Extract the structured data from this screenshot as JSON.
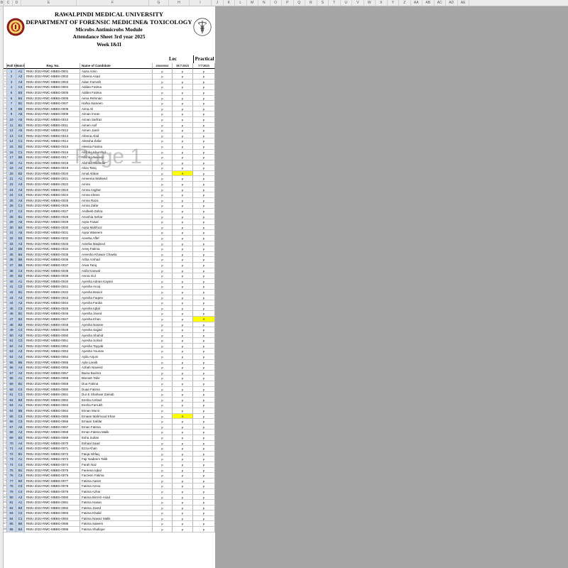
{
  "column_letters": [
    "B",
    "C",
    "D",
    "E",
    "F",
    "G",
    "H",
    "I",
    "J",
    "K",
    "L",
    "M",
    "N",
    "O",
    "P",
    "Q",
    "R",
    "S",
    "T",
    "U",
    "V",
    "W",
    "X",
    "Y",
    "Z",
    "AA",
    "AB",
    "AC",
    "AD",
    "AE"
  ],
  "header": {
    "university": "RAWALPINDI MEDICAL UNIVERSITY",
    "department": "DEPARTMENT OF FORENSIC MEDICINE& TOXICOLOGY",
    "module": "Microbs Antimicrobs Module",
    "sheet": "Attendance Sheet 3rd year 2025",
    "week": "Week I&II"
  },
  "groups": {
    "lec": "Lec",
    "practical": "Practical"
  },
  "columns": {
    "roll": "Roll No.",
    "batch": "Batch",
    "reg": "Reg. No.",
    "name": "Name of Candidate",
    "d1": "########",
    "d2": "18/7/2025",
    "d3": "7/7/2025"
  },
  "watermark": "Page 1",
  "rows": [
    {
      "sr": "3",
      "roll": "1",
      "batch": "A1",
      "reg": "RMU-2022-RMC-MBBS-0001",
      "name": "Aaira Amin",
      "d1": "p",
      "d2": "p",
      "d3": "p"
    },
    {
      "sr": "4",
      "roll": "2",
      "batch": "A2",
      "reg": "RMU-2022-RMC-MBBS-0002",
      "name": "Abeera Asad",
      "d1": "p",
      "d2": "p",
      "d3": "p"
    },
    {
      "sr": "5",
      "roll": "3",
      "batch": "A3",
      "reg": "RMU-2022-RMC-MBBS-0003",
      "name": "Adan Farrukh",
      "d1": "p",
      "d2": "p",
      "d3": "p"
    },
    {
      "sr": "6",
      "roll": "4",
      "batch": "C4",
      "reg": "RMU-2022-RMC-MBBS-0004",
      "name": "Addan Fatima",
      "d1": "p",
      "d2": "p",
      "d3": "p"
    },
    {
      "sr": "7",
      "roll": "5",
      "batch": "B3",
      "reg": "RMU-2022-RMC-MBBS-0005",
      "name": "Adden Fatima",
      "d1": "p",
      "d2": "p",
      "d3": "p"
    },
    {
      "sr": "8",
      "roll": "6",
      "batch": "B4",
      "reg": "RMU-2022-RMC-MBBS-0006",
      "name": "Aena Rehman",
      "d1": "p",
      "d2": "p",
      "d3": "p"
    },
    {
      "sr": "9",
      "roll": "7",
      "batch": "B1",
      "reg": "RMU-2022-RMC-MBBS-0007",
      "name": "Hafsa Sameen",
      "d1": "p",
      "d2": "p",
      "d3": "p"
    },
    {
      "sr": "10",
      "roll": "8",
      "batch": "B5",
      "reg": "RMU-2022-RMC-MBBS-0008",
      "name": "Aima Ali",
      "d1": "p",
      "d2": "p",
      "d3": "p"
    },
    {
      "sr": "11",
      "roll": "9",
      "batch": "A5",
      "reg": "RMU-2022-RMC-MBBS-0009",
      "name": "Aiman Imran",
      "d1": "p",
      "d2": "p",
      "d3": "p"
    },
    {
      "sr": "12",
      "roll": "10",
      "batch": "A5",
      "reg": "RMU-2022-RMC-MBBS-0010",
      "name": "Aiman Sarfraz",
      "d1": "p",
      "d2": "p",
      "d3": "p"
    },
    {
      "sr": "13",
      "roll": "11",
      "batch": "B1",
      "reg": "RMU-2022-RMC-MBBS-0011",
      "name": "Aimen Asif",
      "d1": "p",
      "d2": "p",
      "d3": "p"
    },
    {
      "sr": "14",
      "roll": "12",
      "batch": "A5",
      "reg": "RMU-2022-RMC-MBBS-0012",
      "name": "Aimen Jamil",
      "d1": "p",
      "d2": "p",
      "d3": "p"
    },
    {
      "sr": "15",
      "roll": "13",
      "batch": "C4",
      "reg": "RMU-2022-RMC-MBBS-0013",
      "name": "Afeena Abid",
      "d1": "p",
      "d2": "p",
      "d3": "p"
    },
    {
      "sr": "16",
      "roll": "14",
      "batch": "C1",
      "reg": "RMU-2022-RMC-MBBS-0014",
      "name": "Aleesha Zafar",
      "d1": "p",
      "d2": "p",
      "d3": "p"
    },
    {
      "sr": "17",
      "roll": "15",
      "batch": "B2",
      "reg": "RMU-2022-RMC-MBBS-0015",
      "name": "Aleena Fatima",
      "d1": "p",
      "d2": "p",
      "d3": "p"
    },
    {
      "sr": "18",
      "roll": "16",
      "batch": "C1",
      "reg": "RMU-2022-RMC-MBBS-0016",
      "name": "Alishba Khurshid",
      "d1": "p",
      "d2": "p",
      "d3": "p"
    },
    {
      "sr": "19",
      "roll": "17",
      "batch": "B5",
      "reg": "RMU-2022-RMC-MBBS-0017",
      "name": "Alishba Naveed",
      "d1": "p",
      "d2": "p",
      "d3": "p"
    },
    {
      "sr": "20",
      "roll": "18",
      "batch": "A1",
      "reg": "RMU-2022-RMC-MBBS-0018",
      "name": "Alishba Sikandar",
      "d1": "p",
      "d2": "p",
      "d3": "p"
    },
    {
      "sr": "21",
      "roll": "19",
      "batch": "A4",
      "reg": "RMU-2022-RMC-MBBS-0019",
      "name": "Aliza Tariq",
      "d1": "p",
      "d2": "p",
      "d3": "p"
    },
    {
      "sr": "22",
      "roll": "20",
      "batch": "B2",
      "reg": "RMU-2022-RMC-MBBS-0020",
      "name": "Amal Abbas",
      "d1": "p",
      "d2": "A",
      "d3": "p"
    },
    {
      "sr": "23",
      "roll": "21",
      "batch": "A1",
      "reg": "RMU-2022-RMC-MBBS-0021",
      "name": "Ameema Waheed",
      "d1": "p",
      "d2": "p",
      "d3": "p"
    },
    {
      "sr": "24",
      "roll": "22",
      "batch": "A3",
      "reg": "RMU-2022-RMC-MBBS-0022",
      "name": "Amna",
      "d1": "p",
      "d2": "p",
      "d3": "p"
    },
    {
      "sr": "25",
      "roll": "23",
      "batch": "A3",
      "reg": "RMU-2022-RMC-MBBS-0023",
      "name": "Amna Asghar",
      "d1": "p",
      "d2": "p",
      "d3": "p"
    },
    {
      "sr": "26",
      "roll": "24",
      "batch": "C4",
      "reg": "RMU-2022-RMC-MBBS-0024",
      "name": "Amna Idrees",
      "d1": "p",
      "d2": "p",
      "d3": "p"
    },
    {
      "sr": "27",
      "roll": "25",
      "batch": "A4",
      "reg": "RMU-2022-RMC-MBBS-0025",
      "name": "Amna Raza",
      "d1": "p",
      "d2": "p",
      "d3": "p"
    },
    {
      "sr": "28",
      "roll": "26",
      "batch": "C1",
      "reg": "RMU-2022-RMC-MBBS-0026",
      "name": "Amna Zafar",
      "d1": "p",
      "d2": "p",
      "d3": "p"
    },
    {
      "sr": "29",
      "roll": "27",
      "batch": "C4",
      "reg": "RMU-2022-RMC-MBBS-0027",
      "name": "Andleeb Zahra",
      "d1": "p",
      "d2": "p",
      "d3": "p"
    },
    {
      "sr": "30",
      "roll": "28",
      "batch": "B1",
      "reg": "RMU-2022-RMC-MBBS-0028",
      "name": "Anoshia Sehar",
      "d1": "p",
      "d2": "p",
      "d3": "p"
    },
    {
      "sr": "31",
      "roll": "29",
      "batch": "A5",
      "reg": "RMU-2022-RMC-MBBS-0029",
      "name": "Aqsa Faisal",
      "d1": "p",
      "d2": "p",
      "d3": "p"
    },
    {
      "sr": "32",
      "roll": "30",
      "batch": "B4",
      "reg": "RMU-2022-RMC-MBBS-0030",
      "name": "Aqsa Mahfooz",
      "d1": "p",
      "d2": "p",
      "d3": "p"
    },
    {
      "sr": "33",
      "roll": "31",
      "batch": "A5",
      "reg": "RMU-2022-RMC-MBBS-0031",
      "name": "Aqsa Waseem",
      "d1": "p",
      "d2": "p",
      "d3": "p"
    },
    {
      "sr": "34",
      "roll": "32",
      "batch": "B3",
      "reg": "RMU-2022-RMC-MBBS-0032",
      "name": "Areeba Affef",
      "d1": "p",
      "d2": "p",
      "d3": "p"
    },
    {
      "sr": "35",
      "roll": "33",
      "batch": "A3",
      "reg": "RMU-2022-RMC-MBBS-0033",
      "name": "Areeba Maqbool",
      "d1": "p",
      "d2": "p",
      "d3": "p"
    },
    {
      "sr": "36",
      "roll": "34",
      "batch": "B5",
      "reg": "RMU-2022-RMC-MBBS-0034",
      "name": "Areej Fatima",
      "d1": "p",
      "d2": "p",
      "d3": "p"
    },
    {
      "sr": "37",
      "roll": "35",
      "batch": "B4",
      "reg": "RMU-2022-RMC-MBBS-0035",
      "name": "Areesha Khawar Chawla",
      "d1": "p",
      "d2": "p",
      "d3": "p"
    },
    {
      "sr": "38",
      "roll": "36",
      "batch": "B5",
      "reg": "RMU-2022-RMC-MBBS-0036",
      "name": "Ariba Arshad",
      "d1": "p",
      "d2": "p",
      "d3": "p"
    },
    {
      "sr": "39",
      "roll": "37",
      "batch": "B5",
      "reg": "RMU-2022-RMC-MBBS-0037",
      "name": "Arwa Tariq",
      "d1": "p",
      "d2": "p",
      "d3": "p"
    },
    {
      "sr": "40",
      "roll": "38",
      "batch": "C4",
      "reg": "RMU-2022-RMC-MBBS-0038",
      "name": "Asifa Kanwal",
      "d1": "p",
      "d2": "p",
      "d3": "p"
    },
    {
      "sr": "41",
      "roll": "39",
      "batch": "B2",
      "reg": "RMU-2022-RMC-MBBS-0039",
      "name": "Asma Gul",
      "d1": "p",
      "d2": "p",
      "d3": "p"
    },
    {
      "sr": "42",
      "roll": "40",
      "batch": "A1",
      "reg": "RMU-2022-RMC-MBBS-0040",
      "name": "Ayesha Adnan Kayani",
      "d1": "p",
      "d2": "p",
      "d3": "p"
    },
    {
      "sr": "43",
      "roll": "41",
      "batch": "C2",
      "reg": "RMU-2022-RMC-MBBS-0041",
      "name": "Ayesha Arooj",
      "d1": "p",
      "d2": "p",
      "d3": "p"
    },
    {
      "sr": "44",
      "roll": "42",
      "batch": "B1",
      "reg": "RMU-2022-RMC-MBBS-0042",
      "name": "Ayesha Batool",
      "d1": "p",
      "d2": "p",
      "d3": "p"
    },
    {
      "sr": "45",
      "roll": "43",
      "batch": "A3",
      "reg": "RMU-2022-RMC-MBBS-0043",
      "name": "Ayesha Faqeer",
      "d1": "p",
      "d2": "p",
      "d3": "p"
    },
    {
      "sr": "46",
      "roll": "44",
      "batch": "A2",
      "reg": "RMU-2022-RMC-MBBS-0044",
      "name": "Ayesha Farida",
      "d1": "p",
      "d2": "p",
      "d3": "p"
    },
    {
      "sr": "47",
      "roll": "45",
      "batch": "C3",
      "reg": "RMU-2022-RMC-MBBS-0045",
      "name": "Ayesha Iqbal",
      "d1": "p",
      "d2": "p",
      "d3": "p"
    },
    {
      "sr": "48",
      "roll": "46",
      "batch": "B1",
      "reg": "RMU-2022-RMC-MBBS-0046",
      "name": "Ayesha Javed",
      "d1": "p",
      "d2": "p",
      "d3": "p"
    },
    {
      "sr": "49",
      "roll": "47",
      "batch": "B4",
      "reg": "RMU-2022-RMC-MBBS-0047",
      "name": "Ayesha Khan",
      "d1": "p",
      "d2": "p",
      "d3": "A"
    },
    {
      "sr": "50",
      "roll": "48",
      "batch": "B2",
      "reg": "RMU-2022-RMC-MBBS-0048",
      "name": "Ayesha Naseer",
      "d1": "p",
      "d2": "p",
      "d3": "p"
    },
    {
      "sr": "51",
      "roll": "49",
      "batch": "C4",
      "reg": "RMU-2022-RMC-MBBS-0049",
      "name": "Ayesha Sajjad",
      "d1": "p",
      "d2": "p",
      "d3": "p"
    },
    {
      "sr": "52",
      "roll": "50",
      "batch": "A3",
      "reg": "RMU-2022-RMC-MBBS-0050",
      "name": "Ayesha Shahid",
      "d1": "p",
      "d2": "p",
      "d3": "p"
    },
    {
      "sr": "53",
      "roll": "51",
      "batch": "C3",
      "reg": "RMU-2022-RMC-MBBS-0051",
      "name": "Ayesha Sohail",
      "d1": "p",
      "d2": "p",
      "d3": "p"
    },
    {
      "sr": "54",
      "roll": "52",
      "batch": "A4",
      "reg": "RMU-2022-RMC-MBBS-0052",
      "name": "Ayesha Tayyab",
      "d1": "p",
      "d2": "p",
      "d3": "p"
    },
    {
      "sr": "55",
      "roll": "53",
      "batch": "A3",
      "reg": "RMU-2022-RMC-MBBS-0053",
      "name": "Ayesha Younas",
      "d1": "p",
      "d2": "p",
      "d3": "p"
    },
    {
      "sr": "56",
      "roll": "54",
      "batch": "A4",
      "reg": "RMU-2022-RMC-MBBS-0054",
      "name": "Ayila Anjum",
      "d1": "p",
      "d2": "p",
      "d3": "p"
    },
    {
      "sr": "57",
      "roll": "55",
      "batch": "B5",
      "reg": "RMU-2022-RMC-MBBS-0055",
      "name": "Ayla Laraib",
      "d1": "p",
      "d2": "p",
      "d3": "p"
    },
    {
      "sr": "58",
      "roll": "56",
      "batch": "A4",
      "reg": "RMU-2022-RMC-MBBS-0056",
      "name": "Azbah Naveed",
      "d1": "p",
      "d2": "p",
      "d3": "p"
    },
    {
      "sr": "59",
      "roll": "57",
      "batch": "A2",
      "reg": "RMU-2022-RMC-MBBS-0057",
      "name": "Baina Bushra",
      "d1": "p",
      "d2": "p",
      "d3": "p"
    },
    {
      "sr": "60",
      "roll": "58",
      "batch": "A1",
      "reg": "RMU-2022-RMC-MBBS-0058",
      "name": "Bismah Tahir",
      "d1": "p",
      "d2": "p",
      "d3": "p"
    },
    {
      "sr": "61",
      "roll": "59",
      "batch": "B1",
      "reg": "RMU-2022-RMC-MBBS-0059",
      "name": "Dua Fatima",
      "d1": "p",
      "d2": "p",
      "d3": "p"
    },
    {
      "sr": "62",
      "roll": "60",
      "batch": "C4",
      "reg": "RMU-2022-RMC-MBBS-0060",
      "name": "Duaa Fatima",
      "d1": "p",
      "d2": "p",
      "d3": "p"
    },
    {
      "sr": "63",
      "roll": "61",
      "batch": "C1",
      "reg": "RMU-2022-RMC-MBBS-0061",
      "name": "Dur E Shahwar Zainab",
      "d1": "p",
      "d2": "p",
      "d3": "p"
    },
    {
      "sr": "64",
      "roll": "62",
      "batch": "B3",
      "reg": "RMU-2022-RMC-MBBS-0062",
      "name": "Eesha Arshad",
      "d1": "p",
      "d2": "p",
      "d3": "p"
    },
    {
      "sr": "65",
      "roll": "63",
      "batch": "A1",
      "reg": "RMU-2022-RMC-MBBS-0063",
      "name": "Eesha Farrukh",
      "d1": "p",
      "d2": "p",
      "d3": "p"
    },
    {
      "sr": "66",
      "roll": "64",
      "batch": "B5",
      "reg": "RMU-2022-RMC-MBBS-0064",
      "name": "Eiman Munir",
      "d1": "p",
      "d2": "p",
      "d3": "p"
    },
    {
      "sr": "67",
      "roll": "65",
      "batch": "C4",
      "reg": "RMU-2022-RMC-MBBS-0065",
      "name": "Emaan Mahmood Khan",
      "d1": "p",
      "d2": "A",
      "d3": "p"
    },
    {
      "sr": "68",
      "roll": "66",
      "batch": "C3",
      "reg": "RMU-2022-RMC-MBBS-0066",
      "name": "Emaan Safdar",
      "d1": "p",
      "d2": "p",
      "d3": "p"
    },
    {
      "sr": "69",
      "roll": "67",
      "batch": "A5",
      "reg": "RMU-2022-RMC-MBBS-0067",
      "name": "Eman Fatima",
      "d1": "p",
      "d2": "p",
      "d3": "p"
    },
    {
      "sr": "70",
      "roll": "68",
      "batch": "A4",
      "reg": "RMU-2022-RMC-MBBS-0068",
      "name": "Eman Fatima Malik",
      "d1": "p",
      "d2": "p",
      "d3": "p"
    },
    {
      "sr": "71",
      "roll": "69",
      "batch": "B3",
      "reg": "RMU-2022-RMC-MBBS-0069",
      "name": "Esha Sultan",
      "d1": "p",
      "d2": "p",
      "d3": "p"
    },
    {
      "sr": "72",
      "roll": "70",
      "batch": "A4",
      "reg": "RMU-2022-RMC-MBBS-0070",
      "name": "Eshaal Saad",
      "d1": "p",
      "d2": "p",
      "d3": "p"
    },
    {
      "sr": "73",
      "roll": "71",
      "batch": "A4",
      "reg": "RMU-2022-RMC-MBBS-0071",
      "name": "Ezza Khan",
      "d1": "p",
      "d2": "p",
      "d3": "p"
    },
    {
      "sr": "74",
      "roll": "72",
      "batch": "B1",
      "reg": "RMU-2022-RMC-MBBS-0072",
      "name": "Faiqa Ishfaq",
      "d1": "p",
      "d2": "p",
      "d3": "p"
    },
    {
      "sr": "75",
      "roll": "73",
      "batch": "A1",
      "reg": "RMU-2022-RMC-MBBS-0073",
      "name": "Fajr Nadeem Talib",
      "d1": "p",
      "d2": "p",
      "d3": "p"
    },
    {
      "sr": "76",
      "roll": "74",
      "batch": "C4",
      "reg": "RMU-2022-RMC-MBBS-0074",
      "name": "Farah Naz",
      "d1": "p",
      "d2": "p",
      "d3": "p"
    },
    {
      "sr": "77",
      "roll": "75",
      "batch": "B1",
      "reg": "RMU-2022-RMC-MBBS-0075",
      "name": "Fareena Iqbal",
      "d1": "p",
      "d2": "p",
      "d3": "p"
    },
    {
      "sr": "78",
      "roll": "76",
      "batch": "C4",
      "reg": "RMU-2022-RMC-MBBS-0076",
      "name": "Farzeen Fatima",
      "d1": "p",
      "d2": "p",
      "d3": "p"
    },
    {
      "sr": "79",
      "roll": "77",
      "batch": "B2",
      "reg": "RMU-2022-RMC-MBBS-0077",
      "name": "Fatima Aasim",
      "d1": "p",
      "d2": "p",
      "d3": "p"
    },
    {
      "sr": "80",
      "roll": "78",
      "batch": "C3",
      "reg": "RMU-2022-RMC-MBBS-0078",
      "name": "Fatima Amna",
      "d1": "p",
      "d2": "p",
      "d3": "p"
    },
    {
      "sr": "81",
      "roll": "79",
      "batch": "C4",
      "reg": "RMU-2022-RMC-MBBS-0079",
      "name": "Fatima Azhar",
      "d1": "p",
      "d2": "p",
      "d3": "p"
    },
    {
      "sr": "82",
      "roll": "80",
      "batch": "A3",
      "reg": "RMU-2022-RMC-MBBS-0080",
      "name": "Fatima Binti-E-Asad",
      "d1": "p",
      "d2": "p",
      "d3": "p"
    },
    {
      "sr": "83",
      "roll": "81",
      "batch": "A1",
      "reg": "RMU-2022-RMC-MBBS-0081",
      "name": "Fatima Hasan",
      "d1": "p",
      "d2": "p",
      "d3": "p"
    },
    {
      "sr": "84",
      "roll": "82",
      "batch": "B3",
      "reg": "RMU-2022-RMC-MBBS-0082",
      "name": "Fatima Javed",
      "d1": "p",
      "d2": "p",
      "d3": "p"
    },
    {
      "sr": "85",
      "roll": "83",
      "batch": "C2",
      "reg": "RMU-2022-RMC-MBBS-0083",
      "name": "Fatima Khalid",
      "d1": "p",
      "d2": "p",
      "d3": "p"
    },
    {
      "sr": "86",
      "roll": "84",
      "batch": "C1",
      "reg": "RMU-2022-RMC-MBBS-0084",
      "name": "Fatima Nawaz Malik",
      "d1": "p",
      "d2": "p",
      "d3": "p"
    },
    {
      "sr": "87",
      "roll": "85",
      "batch": "B5",
      "reg": "RMU-2022-RMC-MBBS-0085",
      "name": "Fatima Saleem",
      "d1": "p",
      "d2": "p",
      "d3": "p"
    },
    {
      "sr": "88",
      "roll": "86",
      "batch": "B4",
      "reg": "RMU-2022-RMC-MBBS-0086",
      "name": "Fatima Shafique",
      "d1": "p",
      "d2": "p",
      "d3": "p"
    }
  ]
}
